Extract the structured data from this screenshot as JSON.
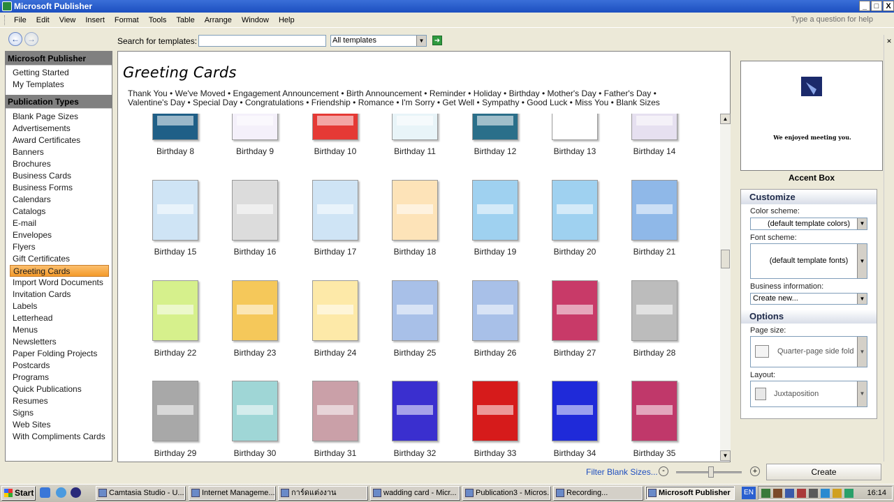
{
  "window": {
    "title": "Microsoft Publisher",
    "controls": [
      "_",
      "□",
      "X"
    ]
  },
  "menu": [
    "File",
    "Edit",
    "View",
    "Insert",
    "Format",
    "Tools",
    "Table",
    "Arrange",
    "Window",
    "Help"
  ],
  "help_box": {
    "placeholder": "Type a question for help"
  },
  "search": {
    "label": "Search for templates:",
    "value": "",
    "scope": "All templates"
  },
  "sidebar": {
    "section1_title": "Microsoft Publisher",
    "section1_items": [
      "Getting Started",
      "My Templates"
    ],
    "section2_title": "Publication Types",
    "section2_items": [
      "Blank Page Sizes",
      "Advertisements",
      "Award Certificates",
      "Banners",
      "Brochures",
      "Business Cards",
      "Business Forms",
      "Calendars",
      "Catalogs",
      "E-mail",
      "Envelopes",
      "Flyers",
      "Gift Certificates",
      "Greeting Cards",
      "Import Word Documents",
      "Invitation Cards",
      "Labels",
      "Letterhead",
      "Menus",
      "Newsletters",
      "Paper Folding Projects",
      "Postcards",
      "Programs",
      "Quick Publications",
      "Resumes",
      "Signs",
      "Web Sites",
      "With Compliments Cards"
    ],
    "selected": "Greeting Cards"
  },
  "main": {
    "title": "Greeting Cards",
    "category_line1": "Thank You • We've Moved • Engagement Announcement • Birth Announcement • Reminder • Holiday  • Birthday  • Mother's Day • Father's Day •",
    "category_line2": "Valentine's Day • Special Day • Congratulations • Friendship • Romance • I'm Sorry • Get Well • Sympathy • Good Luck • Miss You  • Blank Sizes",
    "templates": [
      "Birthday  8",
      "Birthday  9",
      "Birthday 10",
      "Birthday 11",
      "Birthday 12",
      "Birthday 13",
      "Birthday 14",
      "Birthday 15",
      "Birthday 16",
      "Birthday 17",
      "Birthday 18",
      "Birthday 19",
      "Birthday 20",
      "Birthday 21",
      "Birthday 22",
      "Birthday 23",
      "Birthday 24",
      "Birthday 25",
      "Birthday 26",
      "Birthday 27",
      "Birthday 28",
      "Birthday 29",
      "Birthday 30",
      "Birthday 31",
      "Birthday 32",
      "Birthday 33",
      "Birthday 34",
      "Birthday 35"
    ],
    "card_colors": [
      "#1f5f87",
      "#f4f0fa",
      "#e53935",
      "#e8f4f8",
      "#2a6f8a",
      "#ffffff",
      "#e6e0f0",
      "#cfe4f5",
      "#dcdcdc",
      "#cfe4f5",
      "#fde3b8",
      "#9fd1f0",
      "#9fd1f0",
      "#8fb8e8",
      "#d6f08c",
      "#f5c85a",
      "#fde9a8",
      "#a8c0e8",
      "#a8c0e8",
      "#c83a68",
      "#bcbcbc",
      "#a8a8a8",
      "#9fd6d6",
      "#caa0a8",
      "#3a2fcf",
      "#d61b1b",
      "#1f2ad9",
      "#c0386a"
    ]
  },
  "preview": {
    "text": "We enjoyed meeting you.",
    "caption": "Accent Box"
  },
  "customize": {
    "title": "Customize",
    "color_scheme_label": "Color scheme:",
    "color_scheme_value": "(default template colors)",
    "font_scheme_label": "Font scheme:",
    "font_scheme_value": "(default template fonts)",
    "business_info_label": "Business information:",
    "business_info_value": "Create new..."
  },
  "options": {
    "title": "Options",
    "page_size_label": "Page size:",
    "page_size_value": "Quarter-page side fold",
    "layout_label": "Layout:",
    "layout_value": "Juxtaposition"
  },
  "bottom": {
    "filter_link": "Filter Blank Sizes...",
    "create_button": "Create",
    "zoom_minus": "-",
    "zoom_plus": "+"
  },
  "taskbar": {
    "start": "Start",
    "items": [
      "Camtasia Studio - U...",
      "Internet Manageme...",
      "การ์ดแต่งงาน",
      "wadding card - Micr...",
      "Publication3 - Micros...",
      "Recording...",
      "Microsoft Publisher"
    ],
    "active": "Microsoft Publisher",
    "lang": "EN",
    "clock": "16:14"
  }
}
